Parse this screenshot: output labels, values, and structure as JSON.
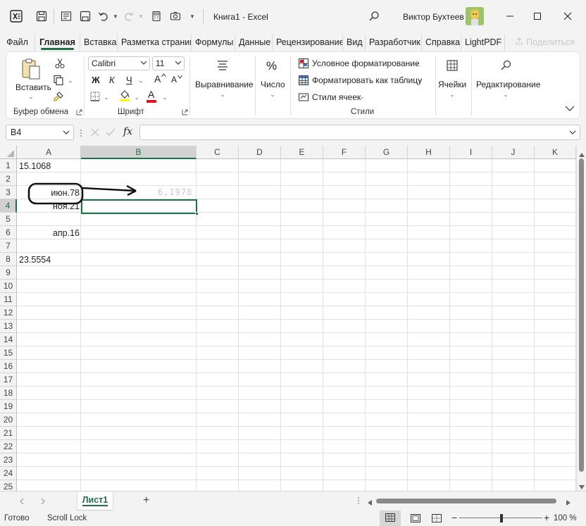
{
  "titlebar": {
    "title": "Книга1  -  Excel",
    "user": "Виктор Бухтеев"
  },
  "menu": {
    "tabs": [
      "Файл",
      "Главная",
      "Вставка",
      "Разметка страниц",
      "Формулы",
      "Данные",
      "Рецензирование",
      "Вид",
      "Разработчик",
      "Справка",
      "LightPDF"
    ],
    "share": "Поделиться"
  },
  "ribbon": {
    "paste_label": "Вставить",
    "clipboard_group": "Буфер обмена",
    "font_name": "Calibri",
    "font_size": "11",
    "font_group": "Шрифт",
    "bold": "Ж",
    "italic": "К",
    "underline": "Ч",
    "font_color_letter": "A",
    "grow_font": "A",
    "shrink_font": "A",
    "alignment_label": "Выравнивание",
    "number_label": "Число",
    "number_icon": "%",
    "conditional_formatting": "Условное форматирование",
    "format_as_table": "Форматировать как таблицу",
    "cell_styles": "Стили ячеек",
    "styles_group": "Стили",
    "cells_label": "Ячейки",
    "editing_label": "Редактирование",
    "font_color": "#e81123",
    "fill_color": "#ffff00"
  },
  "formula_bar": {
    "name_box": "B4",
    "fx": "fx",
    "value": ""
  },
  "grid": {
    "columns": [
      "A",
      "B",
      "C",
      "D",
      "E",
      "F",
      "G",
      "H",
      "I",
      "J",
      "K"
    ],
    "rows": [
      "1",
      "2",
      "3",
      "4",
      "5",
      "6",
      "7",
      "8",
      "9",
      "10",
      "11",
      "12",
      "13",
      "14",
      "15",
      "16",
      "17",
      "18",
      "19",
      "20",
      "21",
      "22",
      "23",
      "24",
      "25"
    ],
    "cells": {
      "A1": "15.1068",
      "A3": "июн.78",
      "A4": "ноя.21",
      "A6": "апр.16",
      "A8": "23.5554"
    },
    "ghost_value": "6,1978",
    "selected_cell": "B4",
    "accent": "#1e7145"
  },
  "sheets": {
    "active": "Лист1",
    "add": "+"
  },
  "status": {
    "ready": "Готово",
    "scroll_lock": "Scroll Lock",
    "zoom": "100 %",
    "zoom_minus": "−",
    "zoom_plus": "+"
  }
}
